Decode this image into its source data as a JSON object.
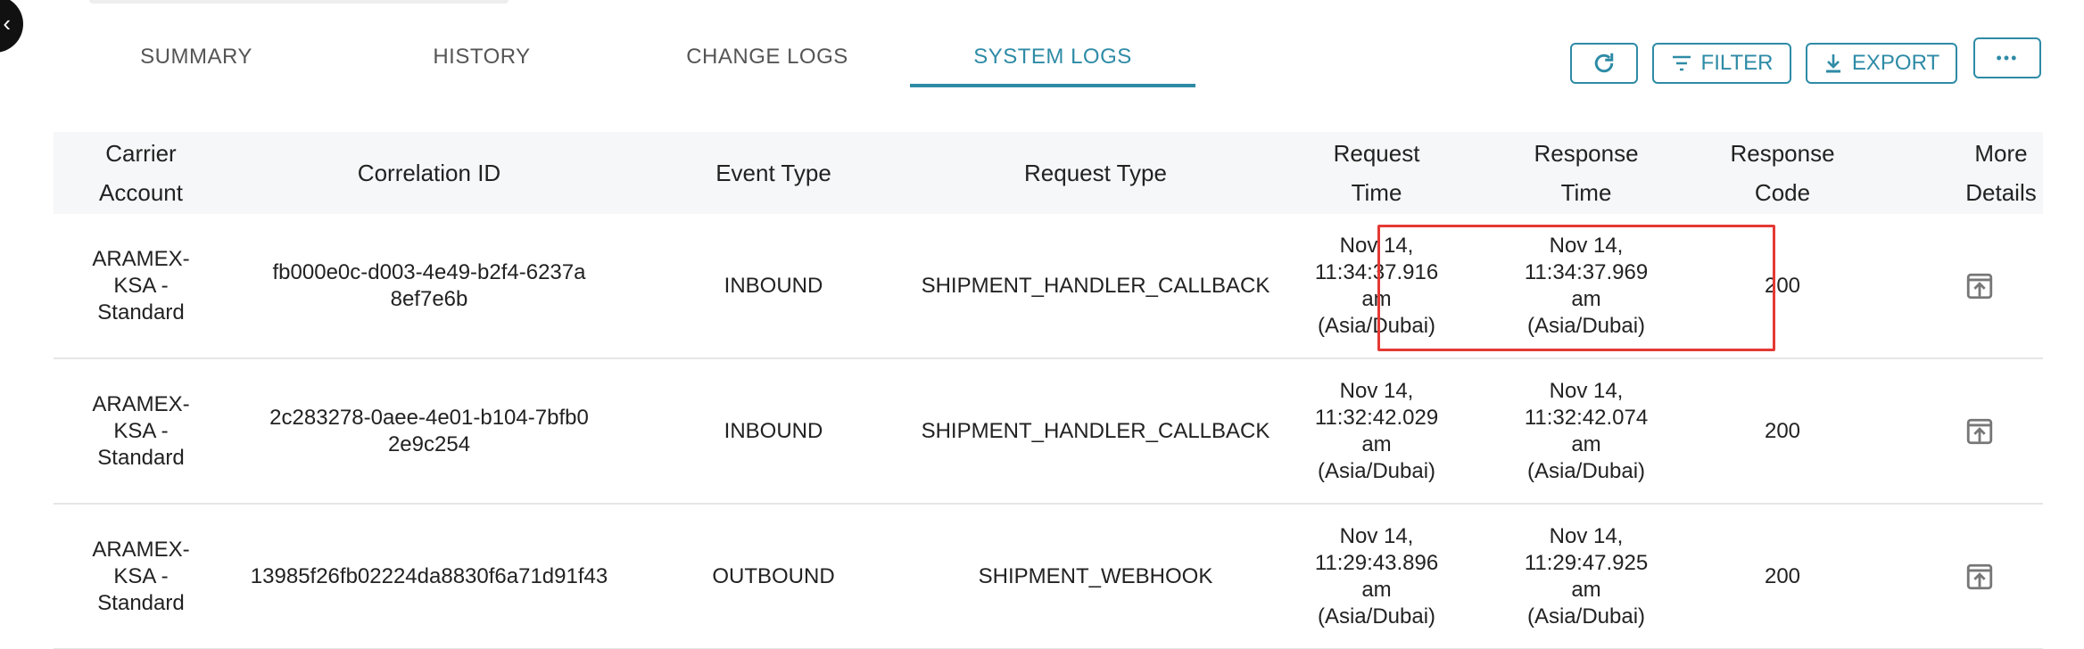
{
  "tabs": [
    {
      "label": "SUMMARY",
      "active": false
    },
    {
      "label": "HISTORY",
      "active": false
    },
    {
      "label": "CHANGE LOGS",
      "active": false
    },
    {
      "label": "SYSTEM LOGS",
      "active": true
    }
  ],
  "toolbar": {
    "refresh_icon": "refresh-icon",
    "filter_label": "FILTER",
    "export_label": "EXPORT",
    "more_label": "•••"
  },
  "table": {
    "headers": [
      "Carrier Account",
      "Correlation ID",
      "Event Type",
      "Request Type",
      "Request Time",
      "Response Time",
      "Response Code",
      "More Details"
    ],
    "rows": [
      {
        "carrier_account": "ARAMEX-KSA - Standard",
        "correlation_id": "fb000e0c-d003-4e49-b2f4-6237a8ef7e6b",
        "event_type": "INBOUND",
        "request_type": "SHIPMENT_HANDLER_CALLBACK",
        "request_time": "Nov 14, 11:34:37.916 am (Asia/Dubai)",
        "response_time": "Nov 14, 11:34:37.969 am (Asia/Dubai)",
        "response_code": "200"
      },
      {
        "carrier_account": "ARAMEX-KSA - Standard",
        "correlation_id": "2c283278-0aee-4e01-b104-7bfb02e9c254",
        "event_type": "INBOUND",
        "request_type": "SHIPMENT_HANDLER_CALLBACK",
        "request_time": "Nov 14, 11:32:42.029 am (Asia/Dubai)",
        "response_time": "Nov 14, 11:32:42.074 am (Asia/Dubai)",
        "response_code": "200"
      },
      {
        "carrier_account": "ARAMEX-KSA - Standard",
        "correlation_id": "13985f26fb02224da8830f6a71d91f43",
        "event_type": "OUTBOUND",
        "request_type": "SHIPMENT_WEBHOOK",
        "request_time": "Nov 14, 11:29:43.896 am (Asia/Dubai)",
        "response_time": "Nov 14, 11:29:47.925 am (Asia/Dubai)",
        "response_code": "200"
      }
    ]
  },
  "colors": {
    "accent": "#2e8ba6",
    "highlight": "#e53935",
    "header_bg": "#f6f7f8"
  }
}
